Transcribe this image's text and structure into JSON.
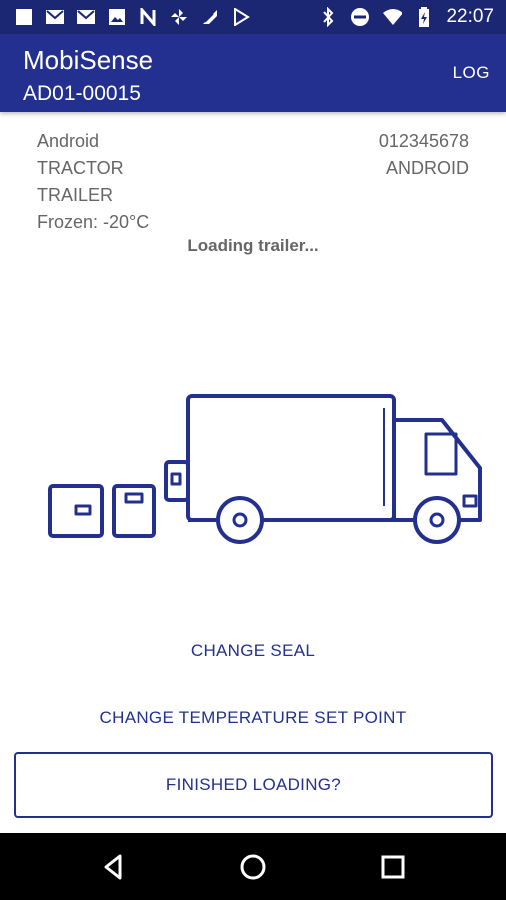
{
  "status_bar": {
    "time": "22:07",
    "left_icons": [
      "notification-square-icon",
      "gmail-icon",
      "gmail-icon",
      "image-icon",
      "n-app-icon",
      "sync-icon",
      "feather-icon",
      "play-store-icon"
    ],
    "right_icons": [
      "bluetooth-icon",
      "do-not-disturb-icon",
      "wifi-icon",
      "battery-icon"
    ]
  },
  "app_bar": {
    "title": "MobiSense",
    "subtitle": "AD01-00015",
    "log_label": "LOG"
  },
  "info": {
    "device": "Android",
    "device_id": "012345678",
    "tractor_label": "TRACTOR",
    "tractor_value": "ANDROID",
    "trailer_label": "TRAILER",
    "temperature": "Frozen: -20°C"
  },
  "status_message": "Loading trailer...",
  "illustration": "truck-loading-icon",
  "actions": {
    "change_seal": "CHANGE SEAL",
    "change_temp": "CHANGE TEMPERATURE SET POINT",
    "finished": "FINISHED LOADING?"
  },
  "colors": {
    "status_bar": "#1c2773",
    "app_bar": "#23308f",
    "accent": "#23308f",
    "nav_bar": "#000000"
  },
  "nav": {
    "back": "back-triangle-icon",
    "home": "home-circle-icon",
    "recents": "recents-square-icon"
  }
}
